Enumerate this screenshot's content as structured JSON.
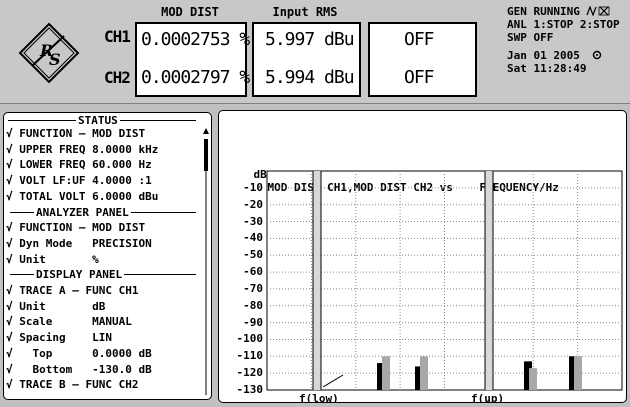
{
  "header": {
    "col1_title": "MOD DIST",
    "col2_title": "Input RMS",
    "ch1_label": "CH1",
    "ch2_label": "CH2",
    "ch1_moddist": "0.0002753 %",
    "ch2_moddist": "0.0002797 %",
    "ch1_rms": "5.997 dBu",
    "ch2_rms": "5.994 dBu",
    "ch1_off": "OFF",
    "ch2_off": "OFF",
    "gen_status": "GEN RUNNING",
    "anl_status": "ANL 1:STOP 2:STOP",
    "swp_status": "SWP OFF",
    "date": "Jan 01 2005",
    "time": "Sat 11:28:49",
    "logo_text": "R&S"
  },
  "status_panel": {
    "title": "STATUS",
    "rows": [
      {
        "type": "row",
        "text": "√ FUNCTION — MOD DIST"
      },
      {
        "type": "row",
        "text": "√ UPPER FREQ 8.0000 kHz"
      },
      {
        "type": "row",
        "text": "√ LOWER FREQ 60.000 Hz"
      },
      {
        "type": "row",
        "text": "√ VOLT LF:UF 4.0000 :1"
      },
      {
        "type": "row",
        "text": "√ TOTAL VOLT 6.0000 dBu"
      },
      {
        "type": "head",
        "text": "ANALYZER PANEL"
      },
      {
        "type": "row",
        "text": "√ FUNCTION — MOD DIST"
      },
      {
        "type": "row",
        "text": "√ Dyn Mode   PRECISION"
      },
      {
        "type": "row",
        "text": "√ Unit       %"
      },
      {
        "type": "head",
        "text": "DISPLAY PANEL"
      },
      {
        "type": "row",
        "text": "√ TRACE A — FUNC CH1"
      },
      {
        "type": "row",
        "text": "√ Unit       dB"
      },
      {
        "type": "row",
        "text": "√ Scale      MANUAL"
      },
      {
        "type": "row",
        "text": "√ Spacing    LIN"
      },
      {
        "type": "row",
        "text": "√   Top      0.0000 dB"
      },
      {
        "type": "row",
        "text": "√   Bottom   -130.0 dB"
      },
      {
        "type": "row",
        "text": "√ TRACE B — FUNC CH2"
      }
    ]
  },
  "graph": {
    "unit_label": "dB",
    "title": "MOD DIST CH1,MOD DIST CH2 vs    FREQUENCY/Hz",
    "x_label_low": "f(low)",
    "x_label_up": "f(up)"
  },
  "chart_data": {
    "type": "bar",
    "title": "MOD DIST CH1,MOD DIST CH2 vs FREQUENCY/Hz",
    "xlabel": "FREQUENCY/Hz",
    "ylabel": "dB",
    "ylim": [
      -130,
      0
    ],
    "yticks": [
      -10,
      -20,
      -30,
      -40,
      -50,
      -60,
      -70,
      -80,
      -90,
      -100,
      -110,
      -120,
      -130
    ],
    "grid": true,
    "x_groups": [
      "f(low)",
      "",
      "f(up)",
      ""
    ],
    "series": [
      {
        "name": "MOD DIST CH1",
        "color": "#000000",
        "values": [
          -114,
          -116,
          -113,
          -110
        ]
      },
      {
        "name": "MOD DIST CH2",
        "color": "#a8a8a8",
        "values": [
          -110,
          -110,
          -117,
          -110
        ]
      }
    ],
    "markers": [
      "f(low)",
      "f(up)"
    ]
  },
  "colors": {
    "background": "#c0c0c0",
    "panel": "#ffffff",
    "bar_ch1": "#000000",
    "bar_ch2": "#a8a8a8",
    "grid": "#9a9a9a"
  }
}
